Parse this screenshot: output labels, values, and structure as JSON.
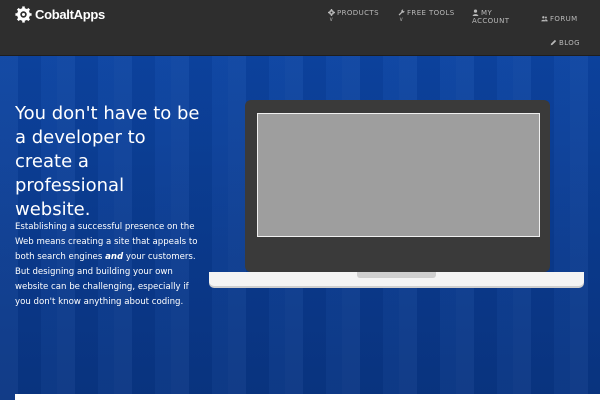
{
  "brand": {
    "name": "CobaltApps"
  },
  "nav": {
    "products": "PRODUCTS",
    "free_tools": "FREE TOOLS",
    "my_account_line1": "MY",
    "my_account_line2": "ACCOUNT",
    "forum": "FORUM",
    "blog": "BLOG",
    "dropdown_glyph": "∨"
  },
  "hero": {
    "headline_line1": "You don't have to be",
    "headline_line2": "a developer to",
    "headline_line3": "create a",
    "headline_line4": "professional",
    "headline_line5": "website.",
    "lede_part1": "Establishing a successful presence on the Web means creating a site that appeals to both search engines ",
    "lede_emphasis": "and",
    "lede_part2": " your customers. But designing and building your own website can be challenging, especially if you don't know anything about coding."
  },
  "icons": {
    "logo": "gear-logo-icon",
    "products": "gear-icon",
    "free_tools": "wrench-icon",
    "my_account": "user-icon",
    "forum": "users-icon",
    "blog": "pencil-icon"
  },
  "colors": {
    "topbar": "#2e2e2e",
    "hero_blue": "#0a3d91",
    "nav_text": "#b9b9b9",
    "laptop_bezel": "#3a3a3a",
    "laptop_display": "#9e9e9e"
  }
}
